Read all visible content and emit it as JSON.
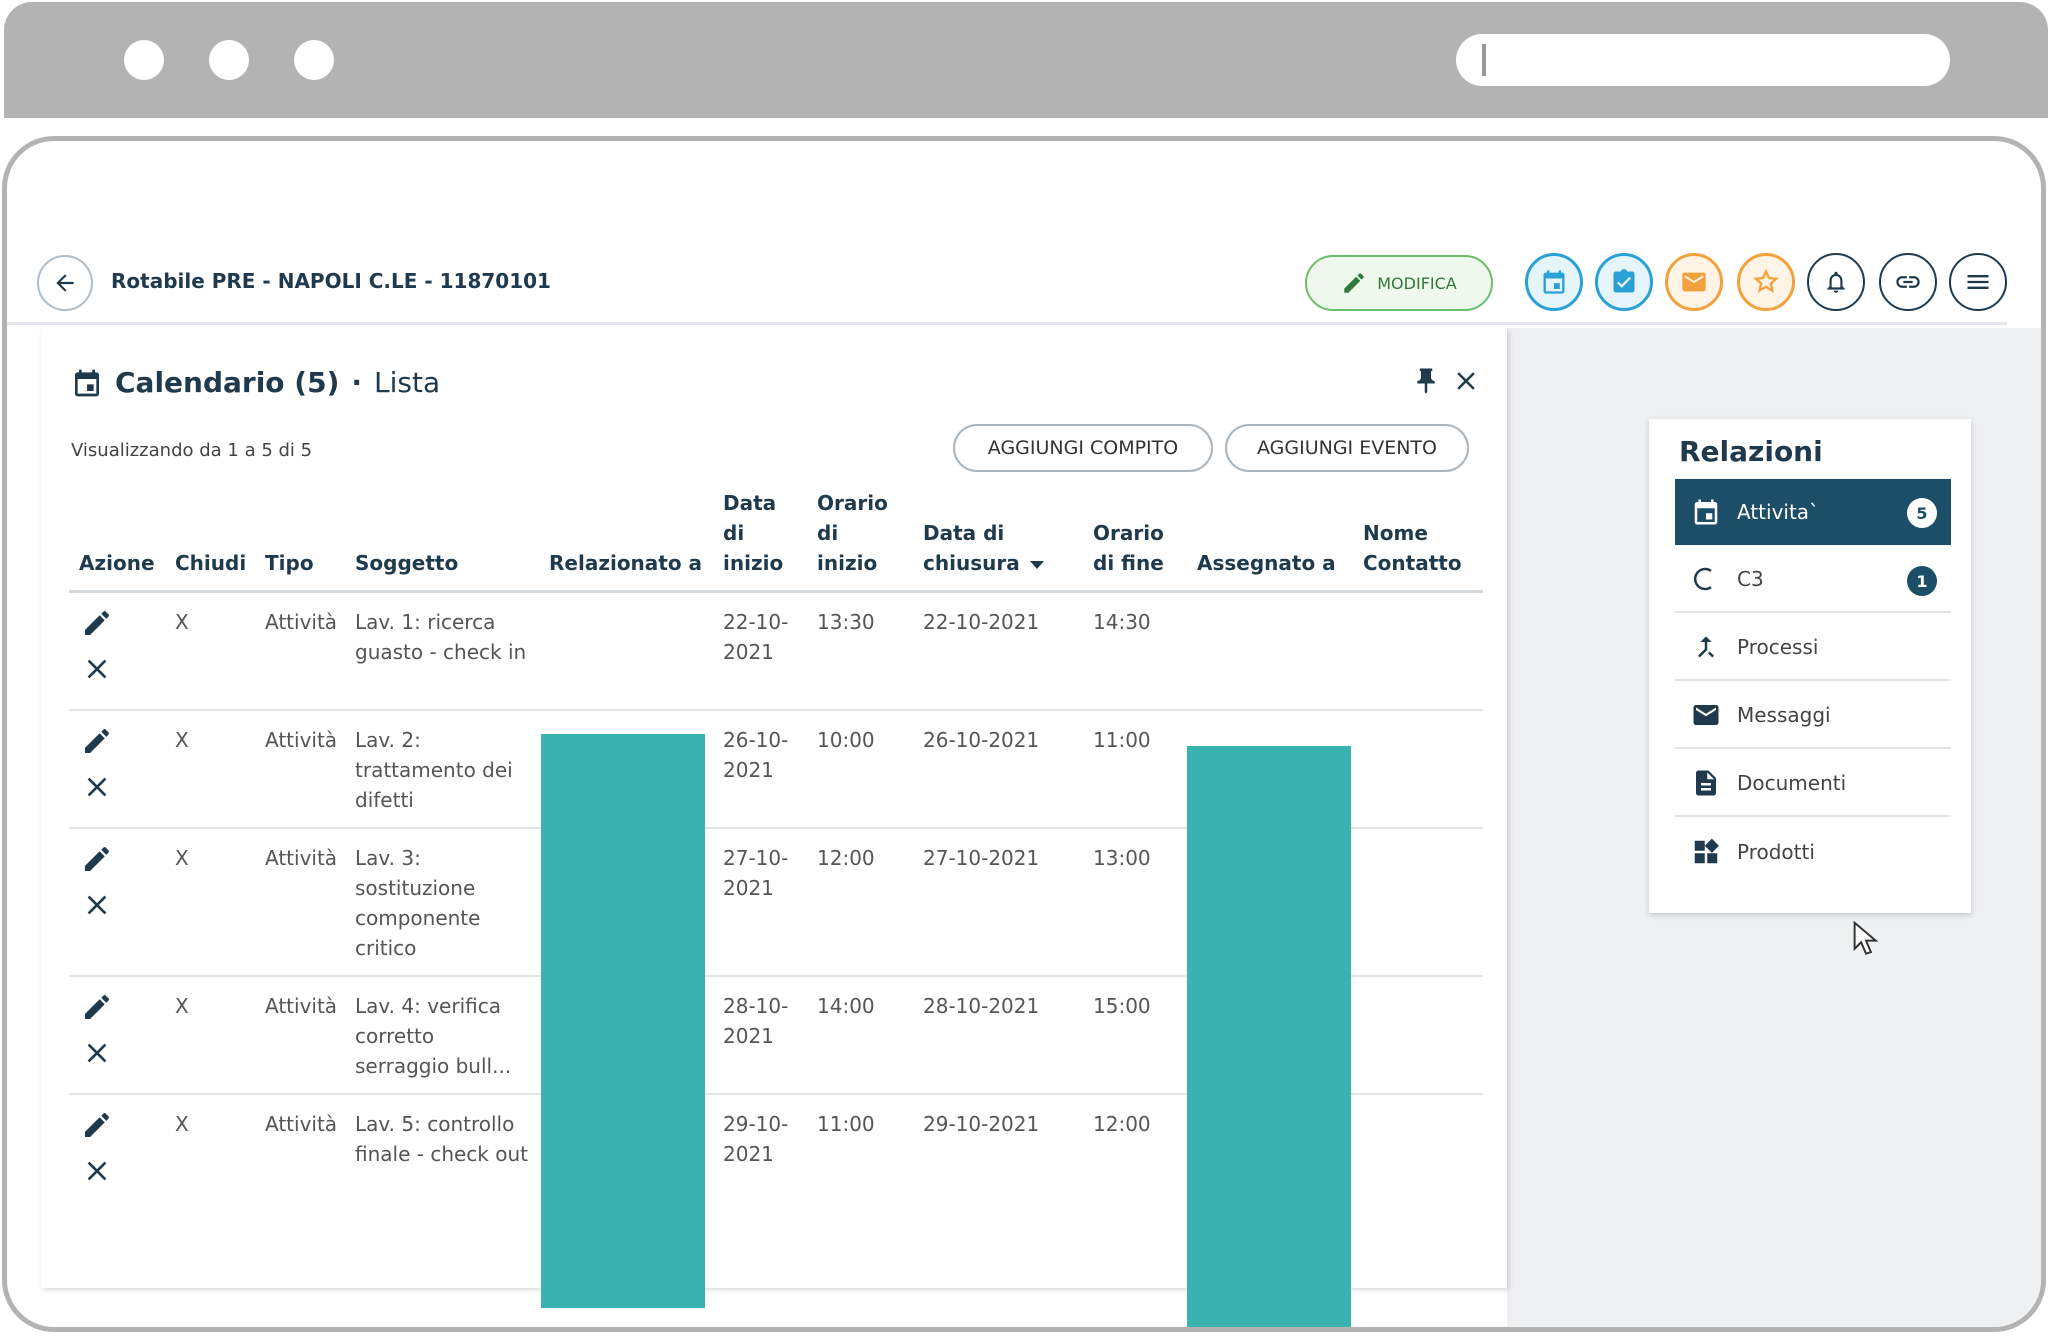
{
  "header": {
    "title": "Rotabile PRE - NAPOLI C.LE - 11870101",
    "modifica_label": "MODIFICA",
    "icons": [
      {
        "name": "calendar-icon",
        "color": "#2aa1d6"
      },
      {
        "name": "task-check-icon",
        "color": "#2aa1d6"
      },
      {
        "name": "mail-icon",
        "color": "#f2a23c"
      },
      {
        "name": "star-icon",
        "color": "#f2a23c"
      },
      {
        "name": "bell-icon",
        "color": "#1f3a4d"
      },
      {
        "name": "link-icon",
        "color": "#1f3a4d"
      },
      {
        "name": "menu-icon",
        "color": "#1f3a4d"
      }
    ]
  },
  "card": {
    "title": "Calendario (5)",
    "separator": "·",
    "subtitle": "Lista",
    "showing": "Visualizzando da 1 a 5 di 5",
    "add_task_label": "AGGIUNGI COMPITO",
    "add_event_label": "AGGIUNGI EVENTO"
  },
  "table": {
    "columns": [
      "Azione",
      "Chiudi",
      "Tipo",
      "Soggetto",
      "Relazionato a",
      "Data di inizio",
      "Orario di inizio",
      "Data di chiusura",
      "Orario di fine",
      "Assegnato a",
      "Nome Contatto"
    ],
    "rows": [
      {
        "chiudi": "X",
        "tipo": "Attività",
        "soggetto": "Lav. 1: ricerca guasto - check in",
        "data_inizio": "22-10-2021",
        "orario_inizio": "13:30",
        "data_chiusura": "22-10-2021",
        "orario_fine": "14:30"
      },
      {
        "chiudi": "X",
        "tipo": "Attività",
        "soggetto": "Lav. 2: trattamento dei difetti",
        "data_inizio": "26-10-2021",
        "orario_inizio": "10:00",
        "data_chiusura": "26-10-2021",
        "orario_fine": "11:00"
      },
      {
        "chiudi": "X",
        "tipo": "Attività",
        "soggetto": "Lav. 3: sostituzione componente critico",
        "data_inizio": "27-10-2021",
        "orario_inizio": "12:00",
        "data_chiusura": "27-10-2021",
        "orario_fine": "13:00"
      },
      {
        "chiudi": "X",
        "tipo": "Attività",
        "soggetto": "Lav. 4: verifica corretto serraggio bull...",
        "data_inizio": "28-10-2021",
        "orario_inizio": "14:00",
        "data_chiusura": "28-10-2021",
        "orario_fine": "15:00"
      },
      {
        "chiudi": "X",
        "tipo": "Attività",
        "soggetto": "Lav. 5: controllo finale - check out",
        "data_inizio": "29-10-2021",
        "orario_inizio": "11:00",
        "data_chiusura": "29-10-2021",
        "orario_fine": "12:00"
      }
    ]
  },
  "relazioni": {
    "title": "Relazioni",
    "items": [
      {
        "label": "Attivita`",
        "icon": "calendar-icon",
        "badge": "5"
      },
      {
        "label": "C3",
        "icon": "c3-icon",
        "badge": "1"
      },
      {
        "label": "Processi",
        "icon": "process-merge-icon"
      },
      {
        "label": "Messaggi",
        "icon": "mail-icon"
      },
      {
        "label": "Documenti",
        "icon": "document-icon"
      },
      {
        "label": "Prodotti",
        "icon": "products-icon"
      }
    ]
  },
  "colors": {
    "primary": "#1d4e67",
    "accent_blue": "#2aa1d6",
    "accent_orange": "#f2a23c",
    "modifica_green": "#6bbf6b",
    "redaction": "#3ab3b0"
  }
}
